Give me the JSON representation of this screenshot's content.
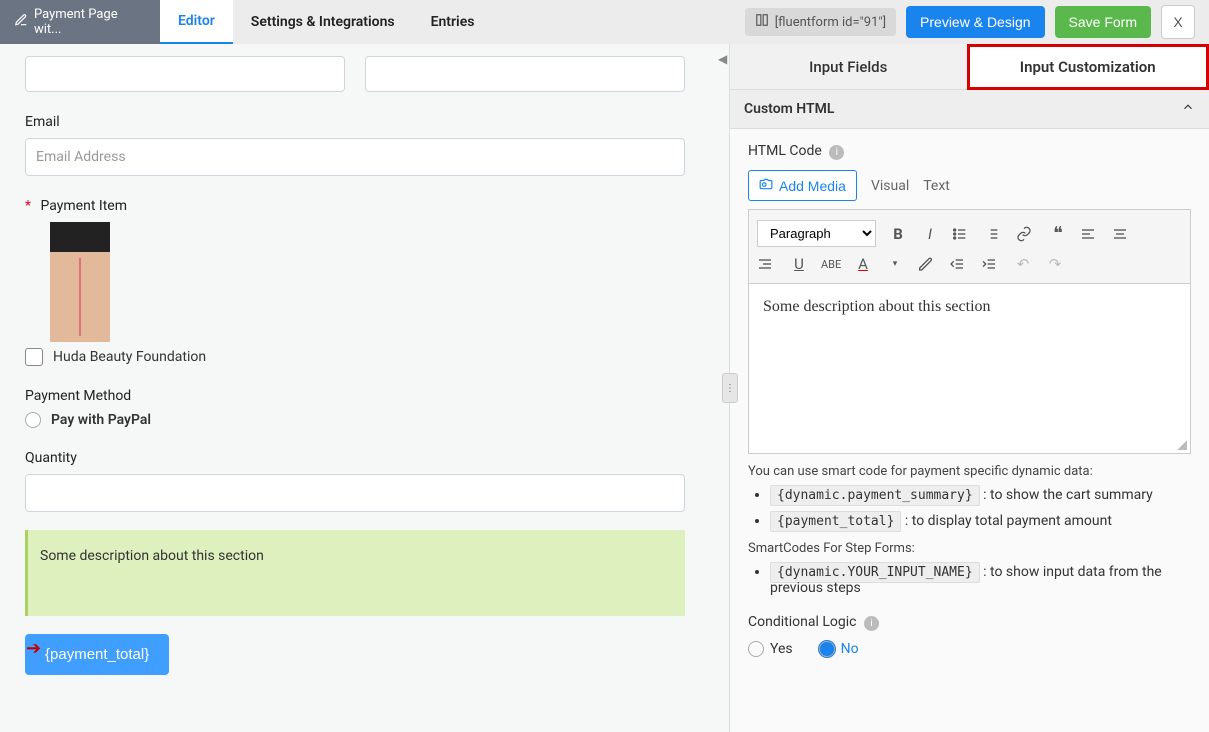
{
  "header": {
    "title": "Payment Page wit...",
    "tabs": {
      "editor": "Editor",
      "settings": "Settings & Integrations",
      "entries": "Entries"
    },
    "shortcode": "[fluentform id=\"91\"]",
    "preview_btn": "Preview & Design",
    "save_btn": "Save Form",
    "close_btn": "X"
  },
  "form": {
    "email_label": "Email",
    "email_placeholder": "Email Address",
    "payment_item_label": "Payment Item",
    "product_option": "Huda Beauty Foundation",
    "payment_method_label": "Payment Method",
    "pay_paypal": "Pay with PayPal",
    "quantity_label": "Quantity",
    "html_block_text": "Some description about this section",
    "payment_total_btn": "{payment_total}"
  },
  "sidebar": {
    "tab_input_fields": "Input Fields",
    "tab_input_customization": "Input Customization",
    "section_title": "Custom HTML",
    "html_code_label": "HTML Code",
    "add_media": "Add Media",
    "mode_visual": "Visual",
    "mode_text": "Text",
    "format_select": "Paragraph",
    "content": "Some description about this section",
    "hint_intro": "You can use smart code for payment specific dynamic data:",
    "hint1_code": "{dynamic.payment_summary}",
    "hint1_text": ": to show the cart summary",
    "hint2_code": "{payment_total}",
    "hint2_text": ": to display total payment amount",
    "step_heading": "SmartCodes For Step Forms:",
    "hint3_code": "{dynamic.YOUR_INPUT_NAME}",
    "hint3_text": ": to show input data from the previous steps",
    "cond_logic_label": "Conditional Logic",
    "yes": "Yes",
    "no": "No"
  }
}
